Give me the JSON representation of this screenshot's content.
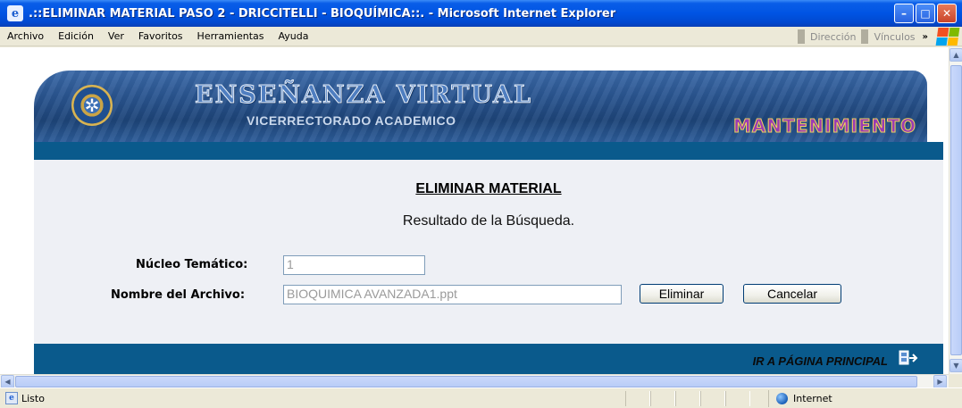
{
  "window": {
    "title": ".::ELIMINAR MATERIAL PASO 2 - DRICCITELLI - BIOQUÍMICA::. - Microsoft Internet Explorer",
    "icon": "ie-icon"
  },
  "menubar": {
    "items": [
      "Archivo",
      "Edición",
      "Ver",
      "Favoritos",
      "Herramientas",
      "Ayuda"
    ],
    "address_label": "Dirección",
    "links_label": "Vínculos",
    "more": "»"
  },
  "banner": {
    "title": "ENSEÑANZA VIRTUAL",
    "subtitle": "VICERRECTORADO ACADEMICO",
    "section": "MANTENIMIENTO"
  },
  "form": {
    "heading": "ELIMINAR MATERIAL",
    "result_text": "Resultado de la Búsqueda.",
    "nucleo_label": "Núcleo Temático:",
    "nucleo_value": "1",
    "archivo_label": "Nombre del Archivo:",
    "archivo_value": "BIOQUIMICA AVANZADA1.ppt",
    "delete_button": "Eliminar",
    "cancel_button": "Cancelar"
  },
  "footer": {
    "main_link": "IR A PÁGINA PRINCIPAL"
  },
  "statusbar": {
    "status": "Listo",
    "zone": "Internet"
  },
  "colors": {
    "ie_blue": "#0054e3",
    "site_bar": "#0a5a8c",
    "panel_bg": "#eef0f5",
    "banner_accent": "#9a3bb3"
  }
}
